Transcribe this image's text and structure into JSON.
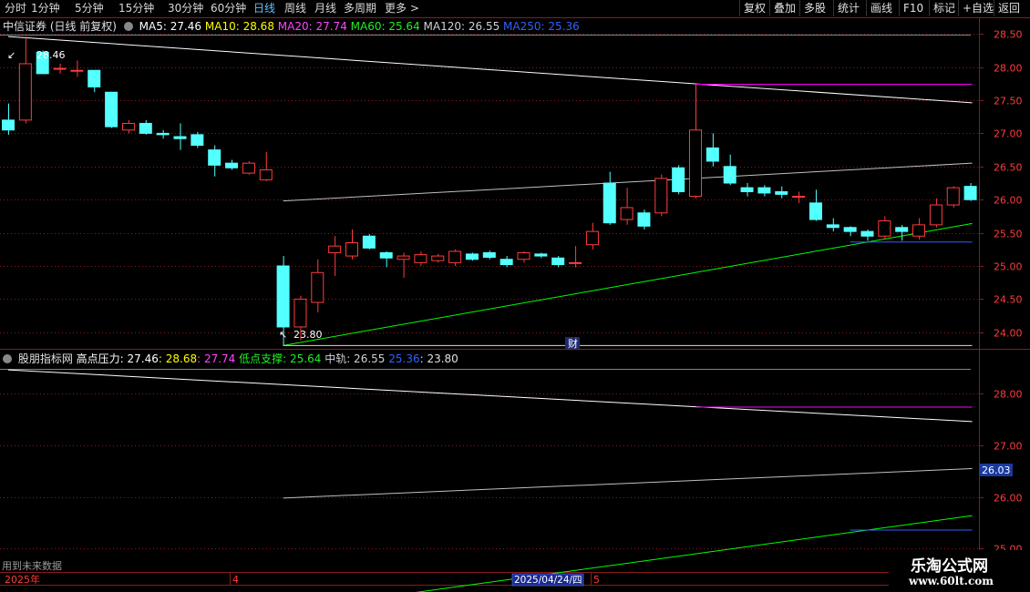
{
  "toolbar": {
    "periods": [
      "分时",
      "1分钟",
      "5分钟",
      "15分钟",
      "30分钟",
      "60分钟",
      "日线",
      "周线",
      "月线",
      "多周期",
      "更多 >"
    ],
    "active_period": "日线",
    "right_buttons": [
      "复权",
      "叠加",
      "多股",
      "统计",
      "画线",
      "F10",
      "标记",
      "+自选",
      "返回"
    ]
  },
  "main_header": {
    "stock": "中信证券 (日线 前复权)",
    "ma5": "MA5: 27.46",
    "ma10": "MA10: 28.68",
    "ma20": "MA20: 27.74",
    "ma60": "MA60: 25.64",
    "ma120": "MA120: 26.55",
    "ma250": "MA250: 25.36"
  },
  "sub_header": {
    "name": "股朋指标网",
    "high_label": "高点压力: 27.46",
    "v1": ": 28.68",
    "v2": ": 27.74",
    "low_label": "低点支撑: 25.64",
    "mid_label": "中轨: 26.55",
    "v3": "25.36",
    "v4": ": 23.80"
  },
  "annotations": {
    "high_price": "28.46",
    "low_price": "23.80",
    "fin_marker": "财",
    "future_note": "用到未来数据"
  },
  "price_axis": {
    "labels": [
      "28.50",
      "28.00",
      "27.50",
      "27.00",
      "26.50",
      "26.00",
      "25.50",
      "25.00",
      "24.50",
      "24.00"
    ]
  },
  "sub_axis": {
    "labels": [
      "28.00",
      "27.00",
      "26.00",
      "25.00"
    ],
    "current_value": "26.03"
  },
  "date_axis": {
    "year": "2025年",
    "m4": "4",
    "selected_date": "2025/04/24/四",
    "m5": "5"
  },
  "watermark": {
    "title": "乐淘公式网",
    "url": "www.60lt.com"
  },
  "colors": {
    "up": "#ff3c3c",
    "down": "#54ffff",
    "ma5": "#ffffff",
    "ma10": "#ffff00",
    "ma20": "#ff00ff",
    "ma60": "#00ff00",
    "ma120": "#c0c0c0",
    "ma250": "#3060ff",
    "grid": "#8c1a1a"
  },
  "chart_data": {
    "type": "candlestick",
    "ylim": [
      23.75,
      28.75
    ],
    "candles": [
      {
        "o": 27.2,
        "c": 27.05,
        "h": 27.45,
        "l": 26.98
      },
      {
        "o": 27.2,
        "c": 28.05,
        "h": 28.46,
        "l": 27.15
      },
      {
        "o": 28.22,
        "c": 27.9,
        "h": 28.25,
        "l": 27.9
      },
      {
        "o": 27.98,
        "c": 27.98,
        "h": 28.05,
        "l": 27.9
      },
      {
        "o": 27.95,
        "c": 27.95,
        "h": 28.1,
        "l": 27.85
      },
      {
        "o": 27.95,
        "c": 27.7,
        "h": 27.95,
        "l": 27.62
      },
      {
        "o": 27.62,
        "c": 27.1,
        "h": 27.62,
        "l": 27.08
      },
      {
        "o": 27.05,
        "c": 27.15,
        "h": 27.2,
        "l": 27.0
      },
      {
        "o": 27.15,
        "c": 27.0,
        "h": 27.2,
        "l": 26.98
      },
      {
        "o": 27.0,
        "c": 26.98,
        "h": 27.05,
        "l": 26.92
      },
      {
        "o": 26.95,
        "c": 26.92,
        "h": 27.15,
        "l": 26.75
      },
      {
        "o": 26.98,
        "c": 26.82,
        "h": 27.02,
        "l": 26.78
      },
      {
        "o": 26.75,
        "c": 26.52,
        "h": 26.82,
        "l": 26.35
      },
      {
        "o": 26.55,
        "c": 26.48,
        "h": 26.6,
        "l": 26.45
      },
      {
        "o": 26.4,
        "c": 26.55,
        "h": 26.58,
        "l": 26.38
      },
      {
        "o": 26.3,
        "c": 26.45,
        "h": 26.72,
        "l": 26.28
      },
      {
        "o": 25.0,
        "c": 24.08,
        "h": 25.15,
        "l": 23.8
      },
      {
        "o": 24.08,
        "c": 24.5,
        "h": 24.55,
        "l": 23.88
      },
      {
        "o": 24.45,
        "c": 24.9,
        "h": 25.1,
        "l": 24.3
      },
      {
        "o": 25.2,
        "c": 25.3,
        "h": 25.45,
        "l": 24.85
      },
      {
        "o": 25.15,
        "c": 25.35,
        "h": 25.55,
        "l": 25.1
      },
      {
        "o": 25.45,
        "c": 25.27,
        "h": 25.48,
        "l": 25.25
      },
      {
        "o": 25.2,
        "c": 25.12,
        "h": 25.22,
        "l": 24.98
      },
      {
        "o": 25.1,
        "c": 25.15,
        "h": 25.2,
        "l": 24.82
      },
      {
        "o": 25.05,
        "c": 25.17,
        "h": 25.22,
        "l": 25.0
      },
      {
        "o": 25.08,
        "c": 25.15,
        "h": 25.18,
        "l": 25.05
      },
      {
        "o": 25.05,
        "c": 25.22,
        "h": 25.25,
        "l": 25.0
      },
      {
        "o": 25.18,
        "c": 25.1,
        "h": 25.2,
        "l": 25.08
      },
      {
        "o": 25.2,
        "c": 25.13,
        "h": 25.23,
        "l": 25.1
      },
      {
        "o": 25.1,
        "c": 25.02,
        "h": 25.15,
        "l": 24.98
      },
      {
        "o": 25.1,
        "c": 25.2,
        "h": 25.22,
        "l": 25.05
      },
      {
        "o": 25.18,
        "c": 25.15,
        "h": 25.2,
        "l": 25.12
      },
      {
        "o": 25.12,
        "c": 25.02,
        "h": 25.15,
        "l": 24.98
      },
      {
        "o": 25.05,
        "c": 25.05,
        "h": 25.3,
        "l": 24.98
      },
      {
        "o": 25.32,
        "c": 25.52,
        "h": 25.65,
        "l": 25.25
      },
      {
        "o": 26.25,
        "c": 25.65,
        "h": 26.42,
        "l": 25.62
      },
      {
        "o": 25.7,
        "c": 25.88,
        "h": 26.18,
        "l": 25.62
      },
      {
        "o": 25.8,
        "c": 25.6,
        "h": 25.85,
        "l": 25.55
      },
      {
        "o": 25.8,
        "c": 26.32,
        "h": 26.38,
        "l": 25.75
      },
      {
        "o": 26.48,
        "c": 26.12,
        "h": 26.52,
        "l": 26.08
      },
      {
        "o": 26.05,
        "c": 27.05,
        "h": 27.75,
        "l": 26.02
      },
      {
        "o": 26.78,
        "c": 26.58,
        "h": 27.0,
        "l": 26.5
      },
      {
        "o": 26.5,
        "c": 26.25,
        "h": 26.68,
        "l": 26.22
      },
      {
        "o": 26.18,
        "c": 26.12,
        "h": 26.25,
        "l": 26.05
      },
      {
        "o": 26.18,
        "c": 26.1,
        "h": 26.22,
        "l": 26.05
      },
      {
        "o": 26.12,
        "c": 26.08,
        "h": 26.2,
        "l": 26.02
      },
      {
        "o": 26.05,
        "c": 26.05,
        "h": 26.12,
        "l": 25.95
      },
      {
        "o": 25.95,
        "c": 25.7,
        "h": 26.15,
        "l": 25.68
      },
      {
        "o": 25.62,
        "c": 25.58,
        "h": 25.72,
        "l": 25.52
      },
      {
        "o": 25.58,
        "c": 25.52,
        "h": 25.6,
        "l": 25.45
      },
      {
        "o": 25.52,
        "c": 25.45,
        "h": 25.55,
        "l": 25.38
      },
      {
        "o": 25.45,
        "c": 25.68,
        "h": 25.75,
        "l": 25.4
      },
      {
        "o": 25.58,
        "c": 25.52,
        "h": 25.62,
        "l": 25.38
      },
      {
        "o": 25.45,
        "c": 25.62,
        "h": 25.72,
        "l": 25.4
      },
      {
        "o": 25.62,
        "c": 25.92,
        "h": 26.02,
        "l": 25.58
      },
      {
        "o": 25.92,
        "c": 26.18,
        "h": 26.2,
        "l": 25.88
      },
      {
        "o": 26.2,
        "c": 26.0,
        "h": 26.25,
        "l": 25.98
      }
    ],
    "lines": [
      {
        "name": "MA5",
        "start": [
          0,
          28.46
        ],
        "end": [
          56,
          27.46
        ]
      },
      {
        "name": "MA20",
        "start": [
          40,
          27.74
        ],
        "end": [
          56,
          27.74
        ]
      },
      {
        "name": "MA120",
        "start": [
          16,
          25.98
        ],
        "end": [
          56,
          26.55
        ]
      },
      {
        "name": "MA60",
        "start": [
          16,
          23.8
        ],
        "end": [
          56,
          25.64
        ]
      },
      {
        "name": "MA250",
        "start": [
          49,
          25.36
        ],
        "end": [
          56,
          25.36
        ]
      },
      {
        "name": "23.80",
        "start": [
          16,
          23.8
        ],
        "end": [
          56,
          23.8
        ]
      }
    ],
    "sub_ylim": [
      24.55,
      28.85
    ]
  }
}
